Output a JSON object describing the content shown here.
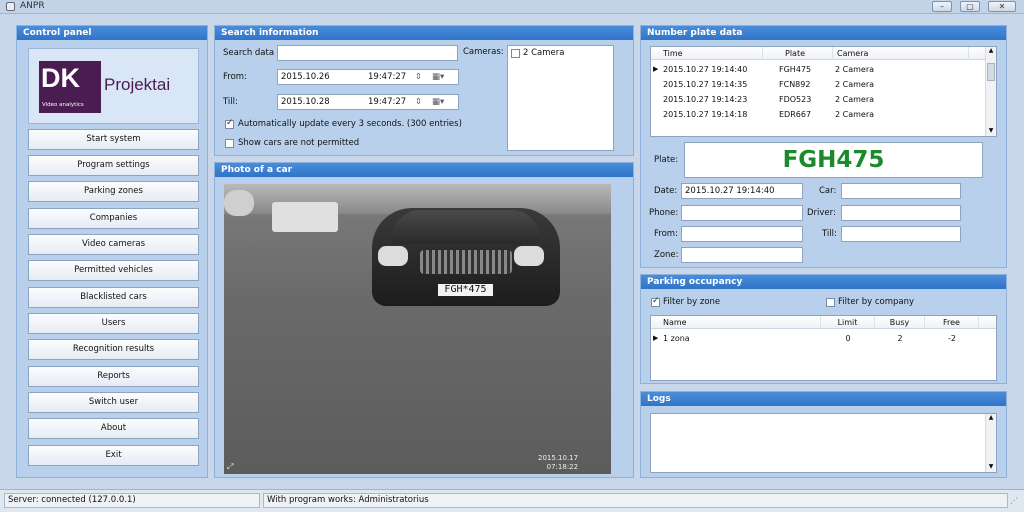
{
  "window": {
    "title": "ANPR"
  },
  "control_panel": {
    "title": "Control panel",
    "logo": {
      "letters": "DK",
      "name": "Projektai",
      "tagline": "Video analytics"
    },
    "buttons": [
      "Start system",
      "Program settings",
      "Parking zones",
      "Companies",
      "Video cameras",
      "Permitted vehicles",
      "Blacklisted cars",
      "Users",
      "Recognition results",
      "Reports",
      "Switch user",
      "About",
      "Exit"
    ]
  },
  "search": {
    "title": "Search information",
    "search_label": "Search data",
    "search_value": "",
    "cameras_label": "Cameras:",
    "camera_item": "2 Camera",
    "from_label": "From:",
    "from_date": "2015.10.26",
    "from_time": "19:47:27",
    "till_label": "Till:",
    "till_date": "2015.10.28",
    "till_time": "19:47:27",
    "auto_update": "Automatically update every 3 seconds. (300 entries)",
    "show_not_permitted": "Show cars are not permitted"
  },
  "photo": {
    "title": "Photo of a car",
    "plate_text": "FGH*475",
    "stamp_date": "2015.10.17",
    "stamp_time": "07:18:22"
  },
  "plate_data": {
    "title": "Number plate data",
    "columns": [
      "Time",
      "Plate",
      "Camera"
    ],
    "rows": [
      {
        "time": "2015.10.27 19:14:40",
        "plate": "FGH475",
        "camera": "2 Camera"
      },
      {
        "time": "2015.10.27 19:14:35",
        "plate": "FCN892",
        "camera": "2 Camera"
      },
      {
        "time": "2015.10.27 19:14:23",
        "plate": "FDO523",
        "camera": "2 Camera"
      },
      {
        "time": "2015.10.27 19:14:18",
        "plate": "EDR667",
        "camera": "2 Camera"
      }
    ],
    "plate_label": "Plate:",
    "plate_value": "FGH475",
    "date_label": "Date:",
    "date_value": "2015.10.27 19:14:40",
    "car_label": "Car:",
    "phone_label": "Phone:",
    "driver_label": "Driver:",
    "from_label": "From:",
    "till_label": "Till:",
    "zone_label": "Zone:"
  },
  "parking": {
    "title": "Parking occupancy",
    "filter_zone": "Filter by zone",
    "filter_company": "Filter by company",
    "columns": [
      "Name",
      "Limit",
      "Busy",
      "Free"
    ],
    "rows": [
      {
        "name": "1 zona",
        "limit": "0",
        "busy": "2",
        "free": "-2"
      }
    ]
  },
  "logs": {
    "title": "Logs"
  },
  "status": {
    "server": "Server: connected (127.0.0.1)",
    "user": "With program works: Administratorius"
  },
  "colors": {
    "accent": "#2f74c7",
    "plate_green": "#1a8a2a"
  }
}
